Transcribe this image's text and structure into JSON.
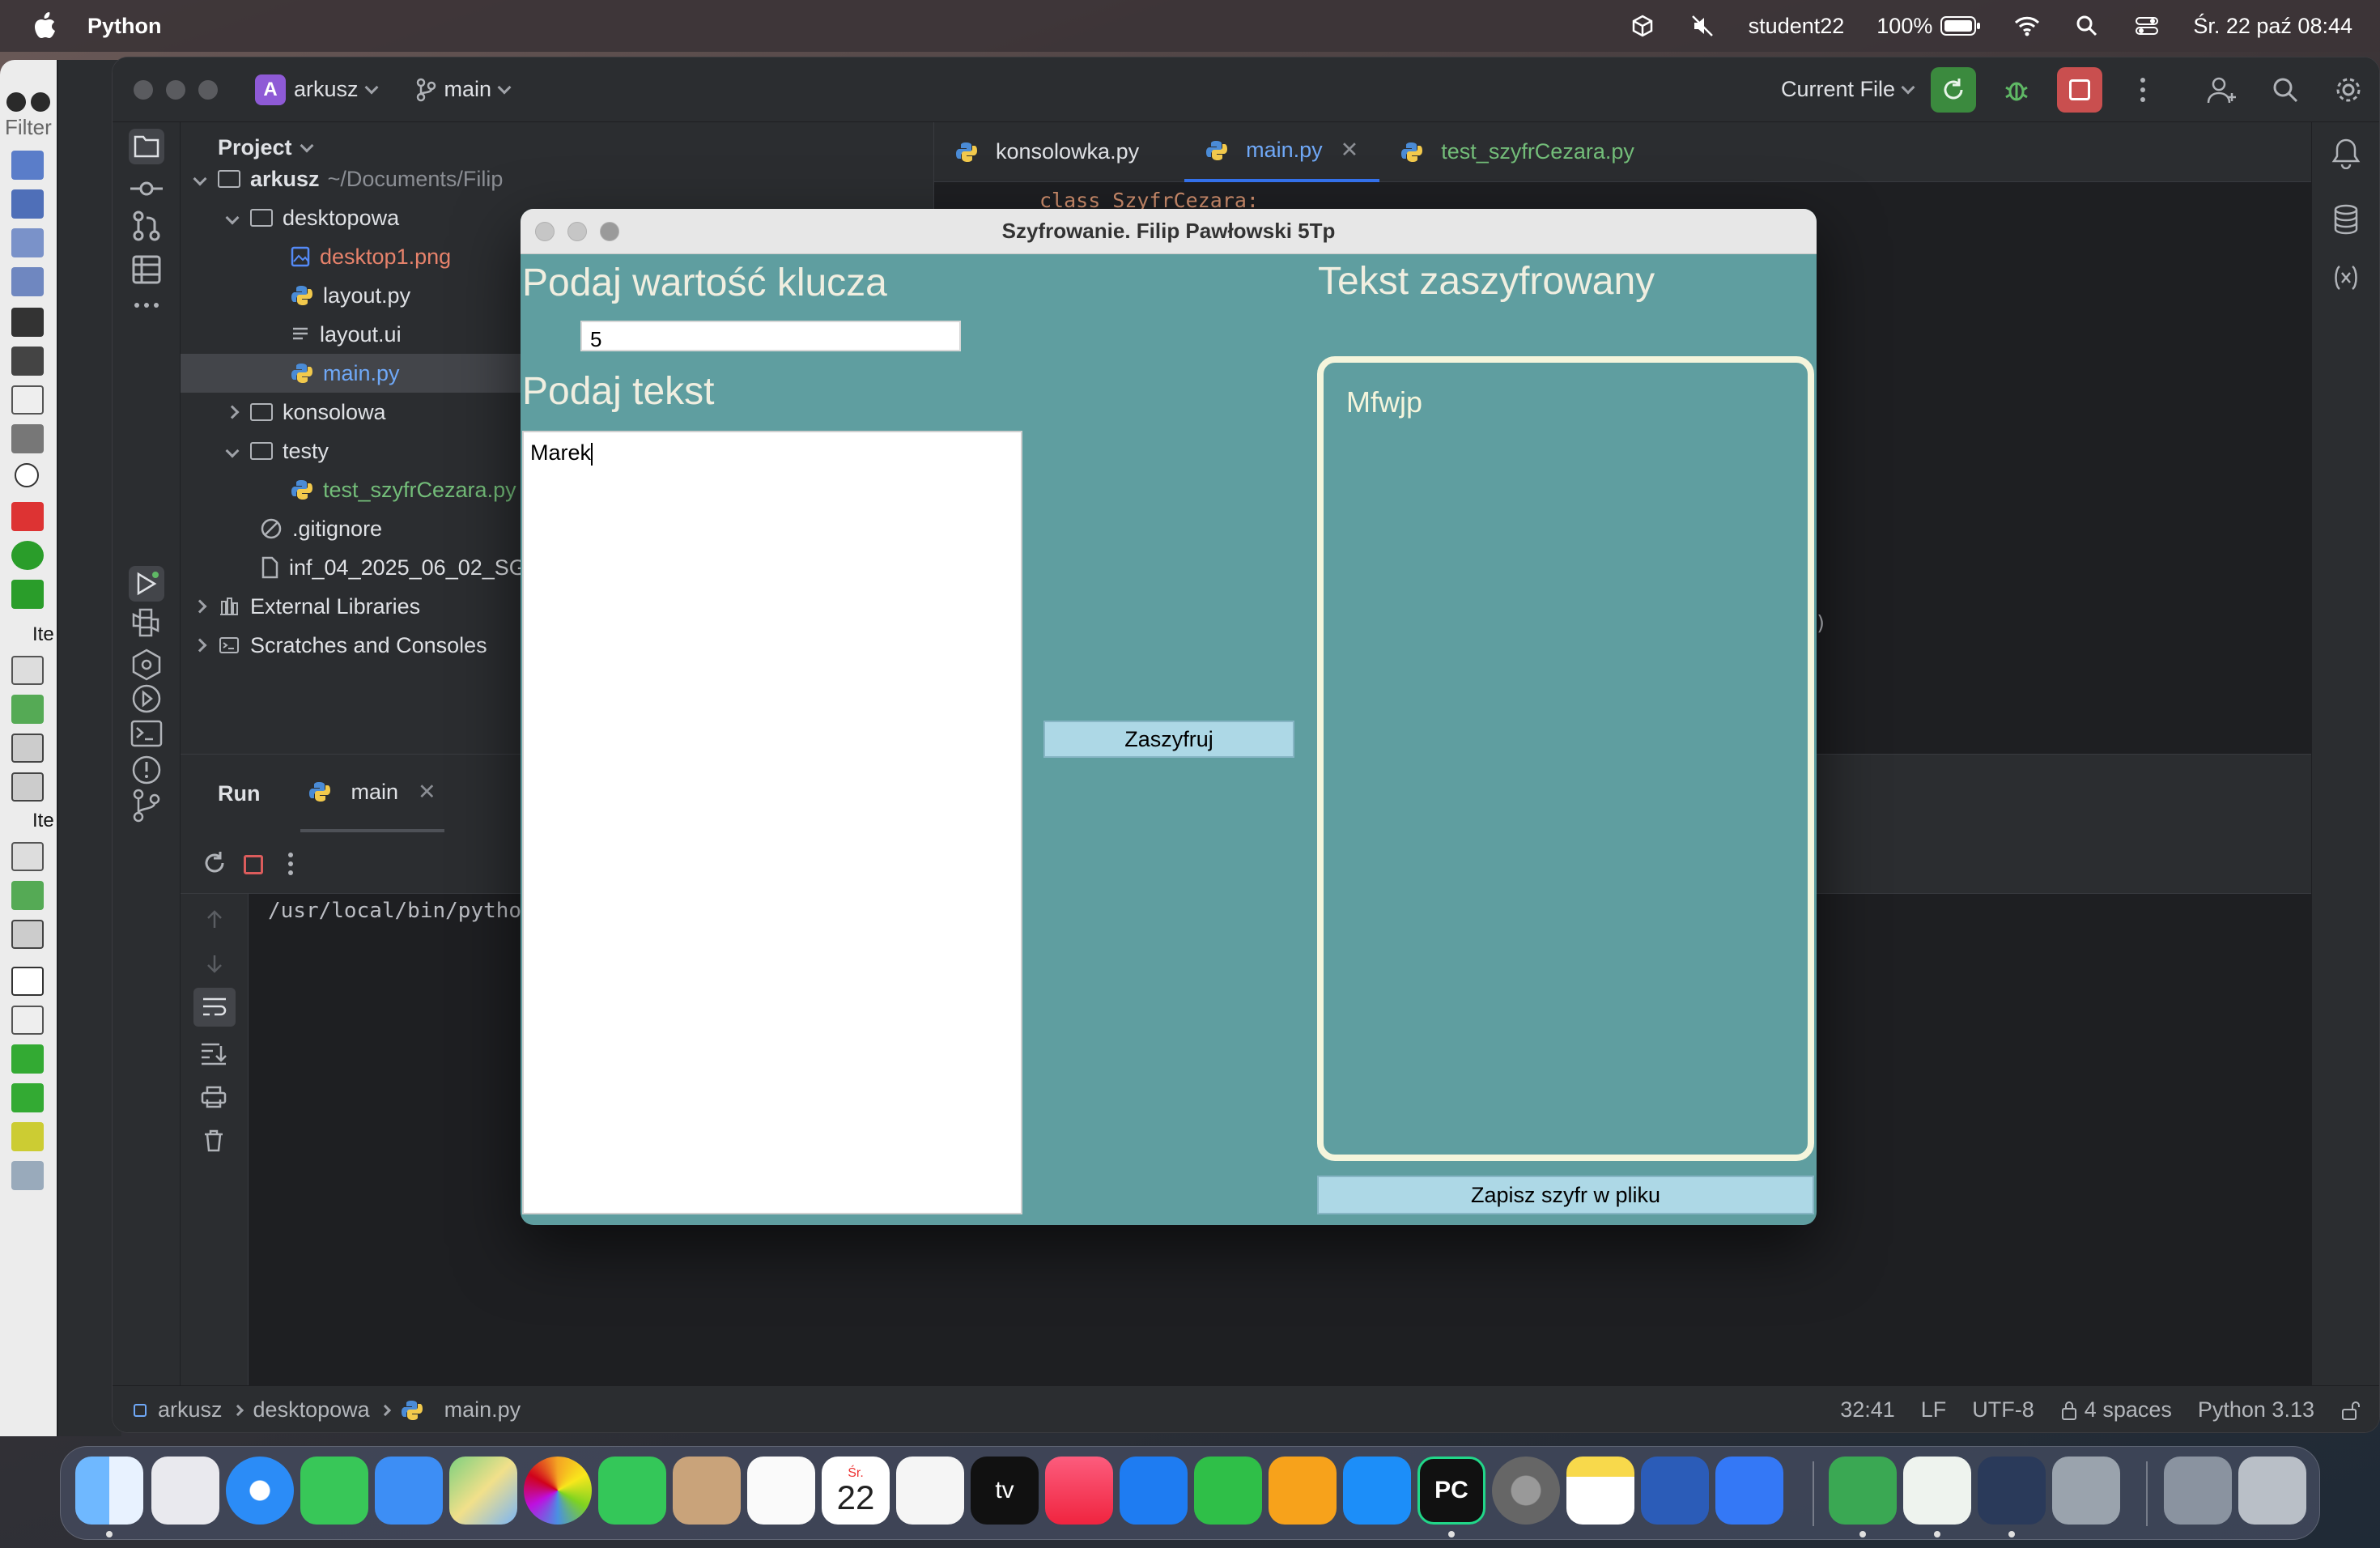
{
  "menubar": {
    "app_name": "Python",
    "user": "student22",
    "battery": "100%",
    "datetime": "Śr. 22 paź  08:44"
  },
  "ide": {
    "project_badge": "A",
    "project_name": "arkusz",
    "branch": "main",
    "run_config": "Current File",
    "project_panel_title": "Project",
    "tree": [
      {
        "label": "arkusz",
        "suffix": "~/Documents/Filip",
        "type": "folder",
        "open": true
      },
      {
        "label": "desktopowa",
        "type": "folder",
        "open": true
      },
      {
        "label": "desktop1.png",
        "type": "image"
      },
      {
        "label": "layout.py",
        "type": "py"
      },
      {
        "label": "layout.ui",
        "type": "text"
      },
      {
        "label": "main.py",
        "type": "py",
        "selected": true
      },
      {
        "label": "konsolowa",
        "type": "folder",
        "open": false
      },
      {
        "label": "testy",
        "type": "folder",
        "open": true
      },
      {
        "label": "test_szyfrCezara.py",
        "type": "py"
      },
      {
        "label": ".gitignore",
        "type": "ignore"
      },
      {
        "label": "inf_04_2025_06_02_SG",
        "type": "file"
      },
      {
        "label": "External Libraries",
        "type": "lib"
      },
      {
        "label": "Scratches and Consoles",
        "type": "scratch"
      }
    ],
    "editor_tabs": [
      {
        "label": "konsolowka.py"
      },
      {
        "label": "main.py",
        "active": true
      },
      {
        "label": "test_szyfrCezara.py"
      }
    ],
    "code_line": "class SzyfrCezara:",
    "code_fragment": ")",
    "run": {
      "title": "Run",
      "tab": "main",
      "output": "/usr/local/bin/python"
    },
    "status": {
      "breadcrumb": [
        "arkusz",
        "desktopowa",
        "main.py"
      ],
      "position": "32:41",
      "line_sep": "LF",
      "encoding": "UTF-8",
      "indent": "4 spaces",
      "interpreter": "Python 3.13"
    }
  },
  "dialog": {
    "title": "Szyfrowanie. Filip Pawłowski 5Tp",
    "key_label": "Podaj wartość klucza",
    "key_value": "5",
    "text_label": "Podaj tekst",
    "text_value": "Marek",
    "encrypt_button": "Zaszyfruj",
    "output_label": "Tekst zaszyfrowany",
    "output_value": "Mfwjp",
    "save_button": "Zapisz szyfr w pliku",
    "colors": {
      "background": "#5f9ea0",
      "button": "#add8e6",
      "text": "#f5f5dc"
    }
  },
  "bg_app": {
    "filter_placeholder": "Filter",
    "group_label_1": "Ite",
    "group_label_2": "Ite"
  },
  "dock": {
    "calendar_month": "Śr.",
    "calendar_day": "22",
    "tv_label": "tv",
    "pycharm_label": "PC"
  }
}
